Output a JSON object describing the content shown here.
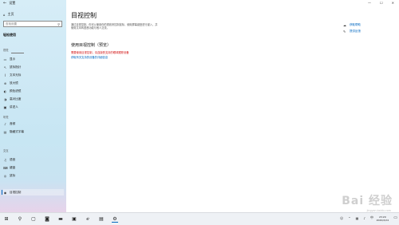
{
  "window": {
    "title": "设置",
    "controls": {
      "minimize": "—",
      "maximize": "☐",
      "close": "✕"
    }
  },
  "sidebar": {
    "home": "主页",
    "search_placeholder": "查找设置",
    "category": "轻松使用",
    "sections": [
      {
        "label": "视觉",
        "items": [
          {
            "label": "显示",
            "icon": "display-icon"
          },
          {
            "label": "鼠标指针",
            "icon": "pointer-icon"
          },
          {
            "label": "文本光标",
            "icon": "cursor-icon"
          },
          {
            "label": "放大镜",
            "icon": "magnifier-icon"
          },
          {
            "label": "颜色滤镜",
            "icon": "color-filter-icon"
          },
          {
            "label": "高对比度",
            "icon": "contrast-icon"
          },
          {
            "label": "讲述人",
            "icon": "narrator-icon"
          }
        ]
      },
      {
        "label": "听觉",
        "items": [
          {
            "label": "音频",
            "icon": "audio-icon"
          },
          {
            "label": "隐藏式字幕",
            "icon": "captions-icon"
          }
        ]
      },
      {
        "label": "交互",
        "items": [
          {
            "label": "语音",
            "icon": "speech-icon"
          },
          {
            "label": "键盘",
            "icon": "keyboard-icon"
          },
          {
            "label": "鼠标",
            "icon": "mouse-icon"
          },
          {
            "label": "目视控制",
            "icon": "eye-control-icon",
            "selected": true
          }
        ]
      }
    ]
  },
  "main": {
    "title": "目视控制",
    "description": "通过目视控制，你可以使用你的视线来控制鼠标，使用屏幕键盘进行键入，并使用文本转语音功能与他人交流。",
    "section_title": "使用目视控制（预览）",
    "warning": "需要使用目视控制，请连接受支持的眼球跟踪设备",
    "link": "获取有关支持的设备的详细信息",
    "right_links": [
      {
        "label": "获取帮助",
        "icon": "help-icon"
      },
      {
        "label": "提供反馈",
        "icon": "feedback-icon"
      }
    ]
  },
  "watermark": {
    "text": "Bai 经验",
    "sub": "jingyan.baidu.com"
  },
  "taskbar": {
    "clock_time": "23:29",
    "clock_date": "2020/2/24",
    "lang": "中"
  }
}
